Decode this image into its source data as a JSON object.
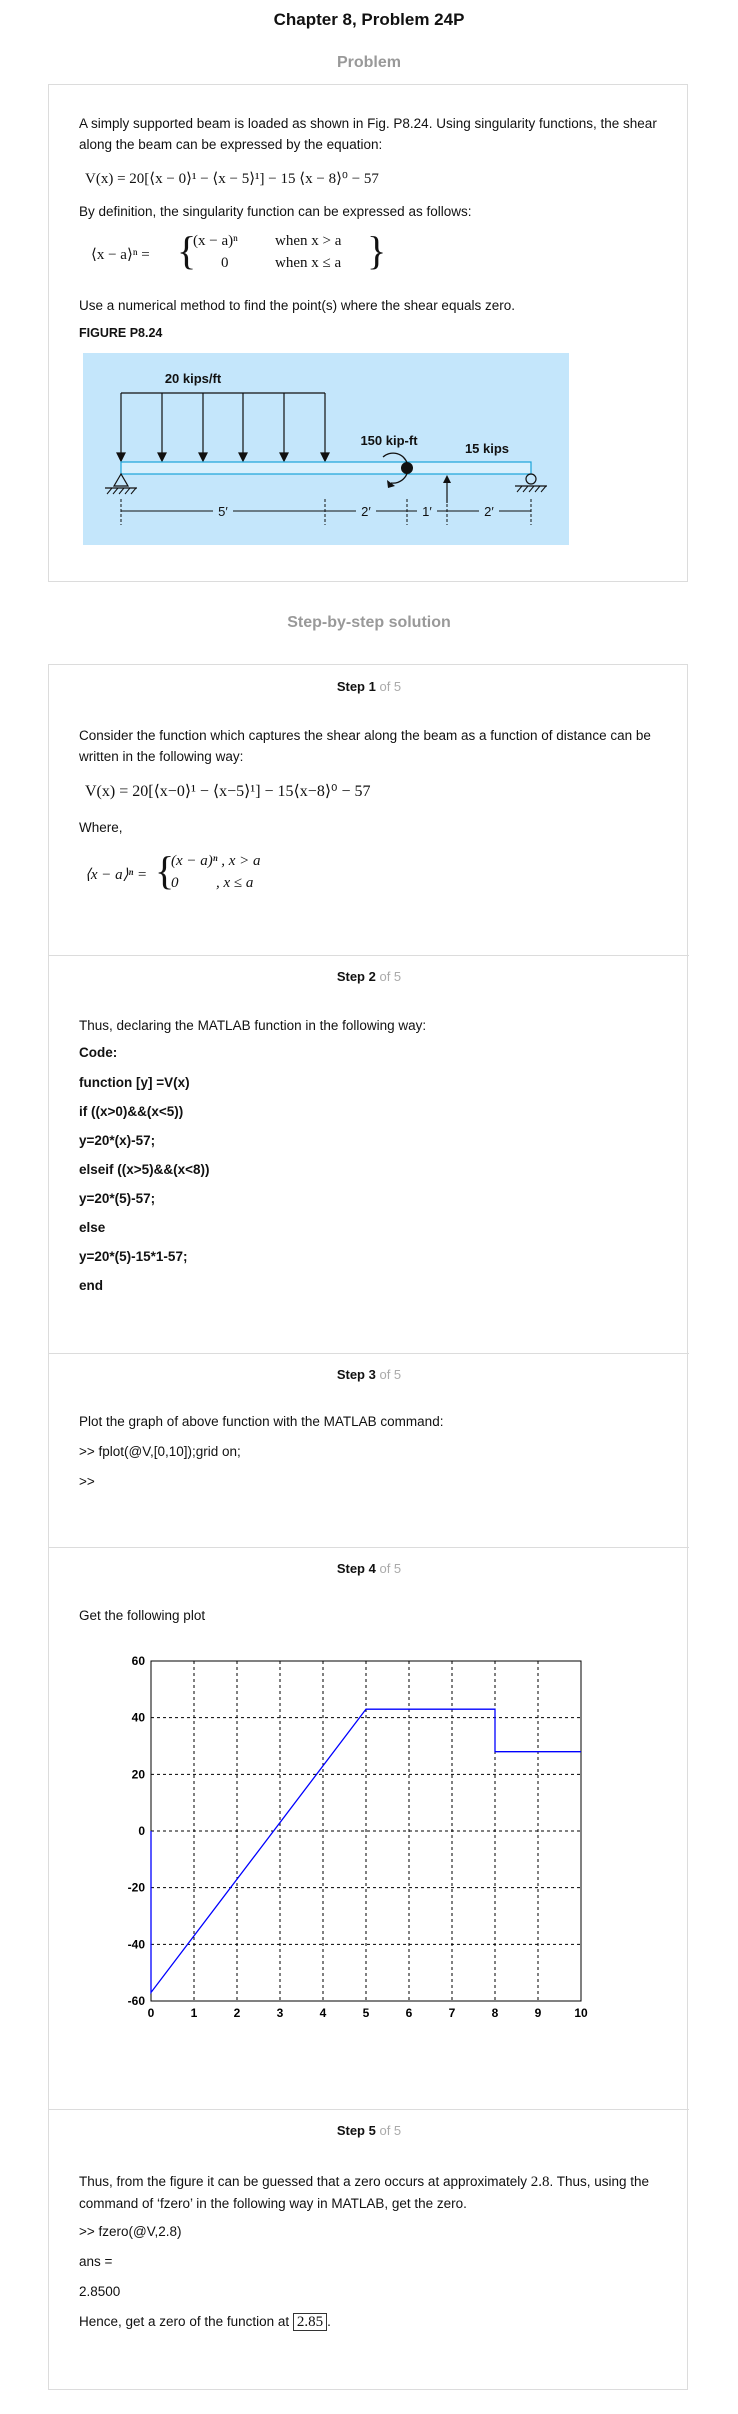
{
  "page": {
    "title": "Chapter 8, Problem 24P",
    "problem_heading": "Problem",
    "solution_heading": "Step-by-step solution"
  },
  "problem": {
    "intro": "A simply supported beam is loaded as shown in Fig. P8.24. Using singularity functions, the shear along the beam can be expressed by the equation:",
    "equation": "V(x) = 20[⟨x − 0⟩¹ − ⟨x − 5⟩¹] − 15 ⟨x − 8⟩⁰ − 57",
    "definition_text": "By definition, the singularity function can be expressed as follows:",
    "def_lhs": "⟨x − a⟩ⁿ =",
    "def_case1_expr": "(x − a)ⁿ",
    "def_case1_cond": "when x > a",
    "def_case2_expr": "0",
    "def_case2_cond": "when x ≤ a",
    "task": "Use a numerical method to find the point(s) where the shear equals zero.",
    "figure_label": "FIGURE P8.24",
    "figure": {
      "distributed_load": "20 kips/ft",
      "moment": "150 kip-ft",
      "point_load": "15 kips",
      "dim1": "5′",
      "dim2": "2′",
      "dim3": "1′",
      "dim4": "2′",
      "background_color": "#c4e6fb"
    }
  },
  "steps": [
    {
      "number": "Step 1",
      "of": "of 5",
      "text1": "Consider the function which captures the shear along the beam as a function of distance can be written in the following way:",
      "equation": "V(x) = 20[⟨x−0⟩¹ − ⟨x−5⟩¹] − 15⟨x−8⟩⁰ − 57",
      "where": "Where,",
      "def_lhs": "⟨x − a⟩ⁿ =",
      "case1": "(x − a)ⁿ , x > a",
      "case2": "0          , x ≤ a"
    },
    {
      "number": "Step 2",
      "of": "of 5",
      "text1": "Thus, declaring the MATLAB function in the following way:",
      "code_label": "Code:",
      "code": [
        "function [y] =V(x)",
        "if ((x>0)&&(x<5))",
        "y=20*(x)-57;",
        "elseif ((x>5)&&(x<8))",
        "y=20*(5)-57;",
        "else",
        "y=20*(5)-15*1-57;",
        "end"
      ]
    },
    {
      "number": "Step 3",
      "of": "of 5",
      "text1": "Plot the graph of above function with the MATLAB command:",
      "cmd1": ">> fplot(@V,[0,10]);grid on;",
      "cmd2": ">>"
    },
    {
      "number": "Step 4",
      "of": "of 5",
      "text1": "Get the following plot"
    },
    {
      "number": "Step 5",
      "of": "of 5",
      "text1a": "Thus, from the figure it can be guessed that a zero occurs at approximately",
      "approx": "2.8",
      "text1b": ". Thus, using the command of ‘fzero’ in the following way in MATLAB, get the zero.",
      "cmd": ">> fzero(@V,2.8)",
      "ans_label": "ans =",
      "ans_value": "2.8500",
      "conclusion": "Hence, get a zero of the function at",
      "result": "2.85",
      "period": "."
    }
  ],
  "chart_data": {
    "type": "line",
    "xlim": [
      0,
      10
    ],
    "ylim": [
      -60,
      60
    ],
    "xticks": [
      "0",
      "1",
      "2",
      "3",
      "4",
      "5",
      "6",
      "7",
      "8",
      "9",
      "10"
    ],
    "yticks": [
      "60",
      "40",
      "20",
      "0",
      "-20",
      "-40",
      "-60"
    ],
    "grid": true,
    "line_color": "#0000ff",
    "series": [
      {
        "x": [
          0,
          0,
          5,
          8,
          8,
          10
        ],
        "y": [
          0,
          -57,
          43,
          43,
          28,
          28
        ]
      }
    ]
  }
}
